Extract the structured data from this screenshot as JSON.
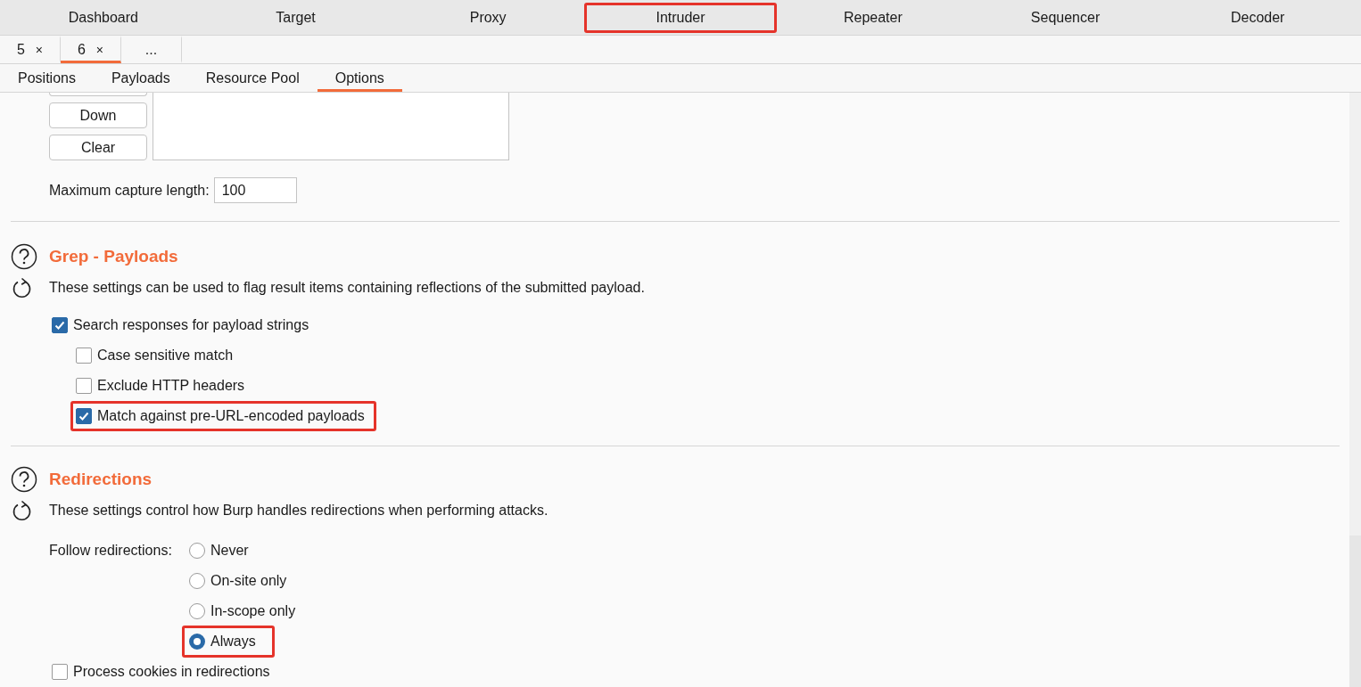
{
  "main_tabs": [
    {
      "label": "Dashboard",
      "highlighted": false
    },
    {
      "label": "Target",
      "highlighted": false
    },
    {
      "label": "Proxy",
      "highlighted": false
    },
    {
      "label": "Intruder",
      "highlighted": true
    },
    {
      "label": "Repeater",
      "highlighted": false
    },
    {
      "label": "Sequencer",
      "highlighted": false
    },
    {
      "label": "Decoder",
      "highlighted": false
    }
  ],
  "attack_tabs": [
    {
      "label": "5",
      "close": "×",
      "selected": false
    },
    {
      "label": "6",
      "close": "×",
      "selected": true
    },
    {
      "label": "...",
      "selected": false
    }
  ],
  "option_tabs": [
    {
      "label": "Positions",
      "selected": false
    },
    {
      "label": "Payloads",
      "selected": false
    },
    {
      "label": "Resource Pool",
      "selected": false
    },
    {
      "label": "Options",
      "selected": true
    }
  ],
  "capture": {
    "buttons": [
      "Down",
      "Clear"
    ],
    "max_length_label": "Maximum capture length:",
    "max_length_value": "100"
  },
  "grep_payloads": {
    "title": "Grep - Payloads",
    "description": "These settings can be used to flag result items containing reflections of the submitted payload.",
    "options": [
      {
        "label": "Search responses for payload strings",
        "checked": true,
        "highlighted": false,
        "children": [
          {
            "label": "Case sensitive match",
            "checked": false,
            "highlighted": false
          },
          {
            "label": "Exclude HTTP headers",
            "checked": false,
            "highlighted": false
          },
          {
            "label": "Match against pre-URL-encoded payloads",
            "checked": true,
            "highlighted": true
          }
        ]
      }
    ]
  },
  "redirections": {
    "title": "Redirections",
    "description": "These settings control how Burp handles redirections when performing attacks.",
    "follow_label": "Follow redirections:",
    "choices": [
      {
        "label": "Never",
        "selected": false,
        "highlighted": false
      },
      {
        "label": "On-site only",
        "selected": false,
        "highlighted": false
      },
      {
        "label": "In-scope only",
        "selected": false,
        "highlighted": false
      },
      {
        "label": "Always",
        "selected": true,
        "highlighted": true
      }
    ],
    "options": [
      {
        "label": "Process cookies in redirections",
        "checked": false,
        "highlighted": false
      }
    ]
  }
}
